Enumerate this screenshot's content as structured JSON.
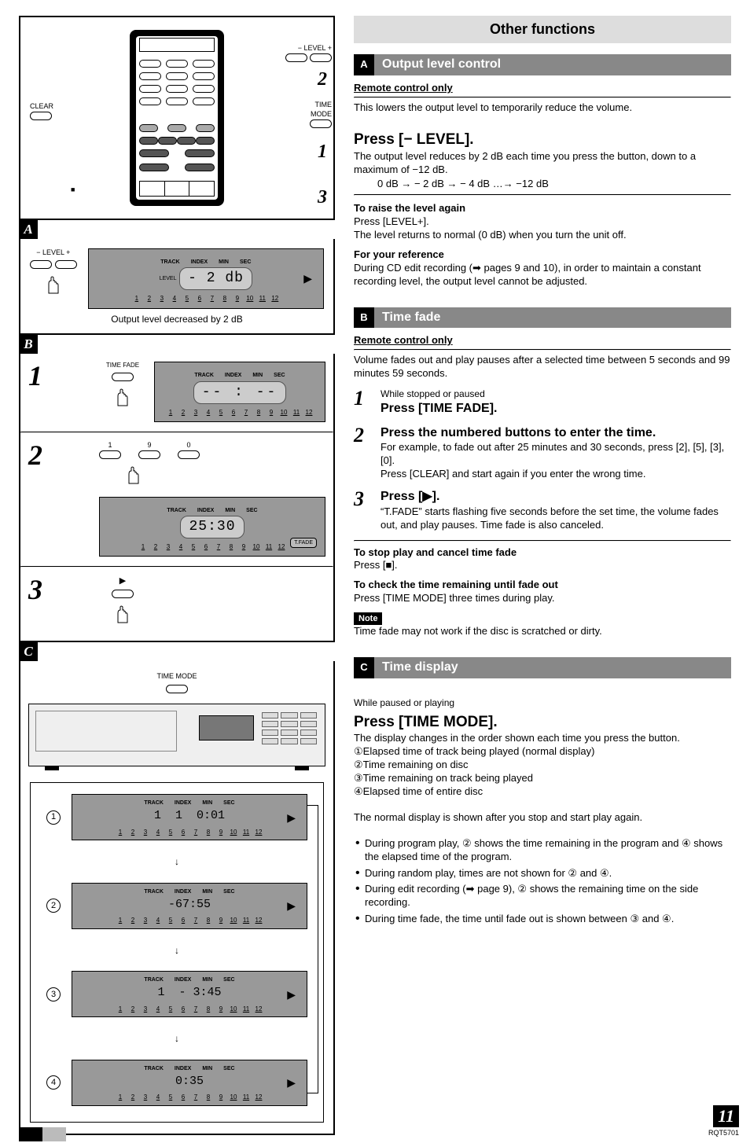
{
  "page_number": "11",
  "doc_code": "RQT5701",
  "left": {
    "remote_labels": {
      "level_minus": "−",
      "level_text": "LEVEL",
      "level_plus": "+",
      "clear": "CLEAR",
      "time_mode": "TIME\nMODE",
      "time_fade": "TIME FADE",
      "callout1": "1",
      "callout2": "2",
      "callout3": "3",
      "stop_box": "■"
    },
    "sectionA": {
      "level_label": "− LEVEL +",
      "caption": "Output level decreased by 2 dB",
      "lcd_label": "LEVEL",
      "lcd_value": "- 2 db",
      "disp_headers": [
        "TRACK",
        "INDEX",
        "MIN",
        "SEC"
      ]
    },
    "sectionB": {
      "step1_label": "TIME FADE",
      "step2_digits": [
        "1",
        "9",
        "0"
      ],
      "step2_lcd": "25:30",
      "tf_label": "T.FADE"
    },
    "sectionC": {
      "title": "TIME MODE",
      "rows": [
        {
          "circ": "1",
          "track": "1",
          "index": "1",
          "time": "0:01"
        },
        {
          "circ": "2",
          "track": "",
          "index": "",
          "time": "-67:55"
        },
        {
          "circ": "3",
          "track": "1",
          "index": "",
          "time": "- 3:45"
        },
        {
          "circ": "4",
          "track": "",
          "index": "",
          "time": "0:35"
        }
      ],
      "disp_headers": [
        "TRACK",
        "INDEX",
        "MIN",
        "SEC"
      ]
    }
  },
  "right": {
    "page_title": "Other functions",
    "A": {
      "letter": "A",
      "title": "Output level control",
      "remote_only": "Remote control only",
      "intro": "This lowers the output level to temporarily reduce the volume.",
      "press_header": "Press [− LEVEL].",
      "press_body": "The output level reduces by 2 dB each time you press the button, down to a maximum of −12 dB.",
      "chain": "0 dB → − 2 dB → − 4 dB …→ −12 dB",
      "raise_h": "To raise the level again",
      "raise_b1": "Press [LEVEL+].",
      "raise_b2": "The level returns to normal (0 dB) when you turn the unit off.",
      "ref_h": "For your reference",
      "ref_b": "During CD edit recording (➡ pages 9 and 10), in order to maintain a constant recording level, the output level cannot be adjusted."
    },
    "B": {
      "letter": "B",
      "title": "Time fade",
      "remote_only": "Remote control only",
      "intro": "Volume fades out and play pauses after a selected time between 5 seconds and 99 minutes 59 seconds.",
      "step1_pre": "While stopped or paused",
      "step1_h": "Press [TIME FADE].",
      "step2_h": "Press the numbered buttons to enter the time.",
      "step2_b1": "For example, to fade out after 25 minutes and 30 seconds, press [2], [5], [3], [0].",
      "step2_b2": "Press [CLEAR] and start again if you enter the wrong time.",
      "step3_h": "Press [▶].",
      "step3_b": "“T.FADE” starts flashing five seconds before the set time, the volume fades out, and play pauses. Time fade is also canceled.",
      "stop_h": "To stop play and cancel time fade",
      "stop_b": "Press [■].",
      "check_h": "To check the time remaining until fade out",
      "check_b": "Press [TIME MODE] three times during play.",
      "note_label": "Note",
      "note_b": "Time fade may not work if the disc is scratched or dirty."
    },
    "C": {
      "letter": "C",
      "title": "Time display",
      "pre": "While paused or playing",
      "press_h": "Press [TIME MODE].",
      "press_b": "The display changes in the order shown each time you press the button.",
      "items": [
        "Elapsed time of track being played (normal display)",
        "Time remaining on disc",
        "Time remaining on track being played",
        "Elapsed time of entire disc"
      ],
      "after": "The normal display is shown after you stop and start play again.",
      "bullets": [
        "During program play, ② shows the time remaining in the program and ④ shows the elapsed time of the program.",
        "During random play, times are not shown for ② and ④.",
        "During edit recording (➡ page 9), ② shows the remaining time on the side recording.",
        "During time fade, the time until fade out is shown between ③ and ④."
      ]
    }
  }
}
